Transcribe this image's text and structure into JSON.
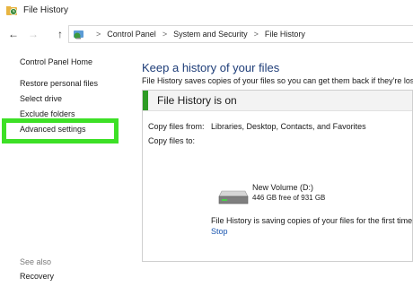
{
  "window": {
    "title": "File History"
  },
  "address": {
    "crumbs": [
      "Control Panel",
      "System and Security",
      "File History"
    ],
    "separator": ">"
  },
  "nav": {
    "back": "←",
    "forward": "→",
    "up": "↑"
  },
  "sidebar": {
    "items": [
      {
        "label": "Control Panel Home"
      },
      {
        "label": "Restore personal files"
      },
      {
        "label": "Select drive"
      },
      {
        "label": "Exclude folders"
      },
      {
        "label": "Advanced settings"
      }
    ],
    "see_also_label": "See also",
    "see_also_items": [
      {
        "label": "Recovery"
      }
    ]
  },
  "main": {
    "heading": "Keep a history of your files",
    "description": "File History saves copies of your files so you can get them back if they're lost or damaged.",
    "status": "File History is on",
    "copy_from_label": "Copy files from:",
    "copy_from_value": "Libraries, Desktop, Contacts, and Favorites",
    "copy_to_label": "Copy files to:",
    "drive_name": "New Volume (D:)",
    "drive_free": "446 GB free of 931 GB",
    "saving_text": "File History is saving copies of your files for the first time.",
    "stop_label": "Stop"
  },
  "colors": {
    "heading": "#1e3d78",
    "highlight": "#3de026",
    "status_bar": "#2d9b24",
    "link": "#1a56b0"
  },
  "icons": [
    "file-history-icon",
    "back-arrow-icon",
    "forward-arrow-icon",
    "up-arrow-icon",
    "control-panel-icon",
    "drive-icon"
  ]
}
